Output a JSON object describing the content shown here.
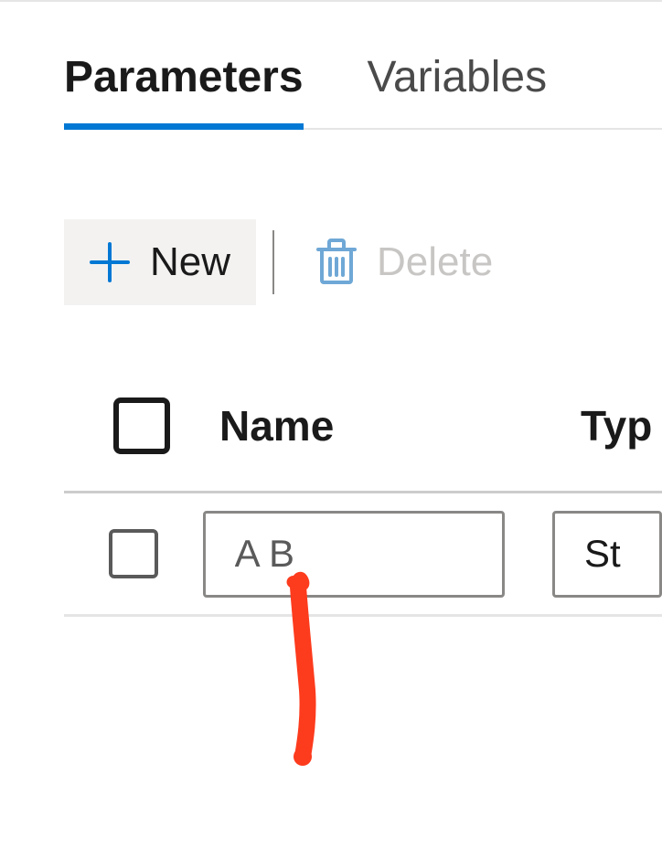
{
  "tabs": {
    "parameters": "Parameters",
    "variables": "Variables"
  },
  "toolbar": {
    "new_label": "New",
    "delete_label": "Delete"
  },
  "table": {
    "headers": {
      "name": "Name",
      "type": "Typ"
    },
    "rows": [
      {
        "name": "A B",
        "type": "St"
      }
    ]
  },
  "colors": {
    "accent": "#0078d4",
    "annotation": "#fd3b1d"
  }
}
